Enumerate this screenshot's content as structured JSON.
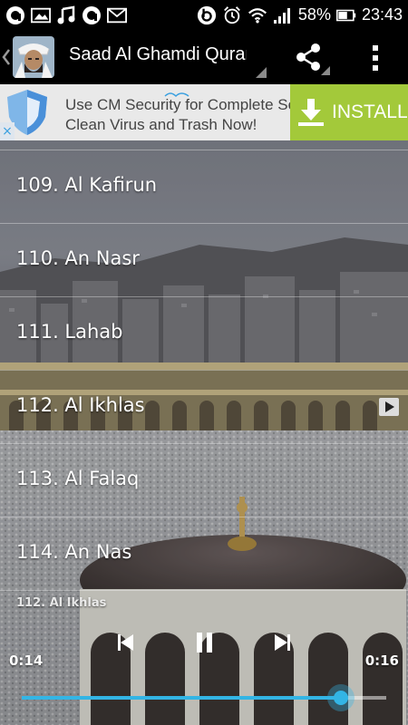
{
  "status_bar": {
    "battery_percent": "58%",
    "time": "23:43",
    "notification_icons": [
      "app-icon",
      "image-icon",
      "music-icon",
      "app-icon",
      "mail-icon"
    ],
    "system_icons": [
      "beats-icon",
      "alarm-icon",
      "wifi-icon",
      "signal-icon",
      "battery-icon"
    ]
  },
  "action_bar": {
    "title": "Saad Al Ghamdi Quran",
    "actions": [
      "share-icon",
      "overflow-menu-icon"
    ]
  },
  "ad": {
    "line1": "Use CM Security for Complete Security.",
    "line2": "Clean Virus and Trash Now!",
    "install_label": "INSTALL",
    "close_glyph": "×"
  },
  "tracks": [
    {
      "label": "109. Al Kafirun"
    },
    {
      "label": "110. An Nasr"
    },
    {
      "label": "111. Lahab"
    },
    {
      "label": "112. Al Ikhlas",
      "playing": true
    },
    {
      "label": "113. Al Falaq"
    },
    {
      "label": "114. An Nas"
    }
  ],
  "player": {
    "now_playing": "112. Al Ikhlas",
    "elapsed": "0:14",
    "duration": "0:16",
    "progress": 0.875,
    "controls": [
      "previous-icon",
      "pause-icon",
      "next-icon"
    ]
  },
  "colors": {
    "accent": "#33b5e5",
    "install_bg": "#a3c93a",
    "ad_bg": "#e9e9e9"
  }
}
